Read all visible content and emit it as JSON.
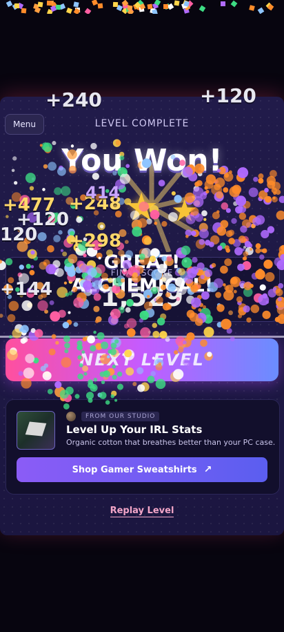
{
  "header": {
    "menu_label": "Menu",
    "status_label": "LEVEL COMPLETE"
  },
  "result": {
    "headline": "You Won!",
    "stars_earned": 2,
    "rating_line1": "GREAT!",
    "rating_line2": "ALCHEMICAL!",
    "final_score_label": "FINAL SCORE",
    "final_score_value": "1,529"
  },
  "score_popups": [
    "+240",
    "+120",
    "+477",
    "+248",
    "+120",
    "120",
    "+298",
    "+144",
    "414"
  ],
  "next_button_label": "NEXT LEVEL",
  "ad": {
    "studio_tag": "FROM OUR STUDIO",
    "title": "Level Up Your IRL Stats",
    "description": "Organic cotton that breathes better than your PC case.",
    "cta_label": "Shop Gamer Sweatshirts",
    "cta_icon": "arrow-up-right-icon"
  },
  "replay_label": "Replay Level",
  "colors": {
    "panel": "#1b1640",
    "star": "#f7c437",
    "next_gradient_start": "#ff4f9e",
    "next_gradient_end": "#6a8dff",
    "shop_button": "#8b5cf6",
    "replay": "#f3a6c8"
  }
}
